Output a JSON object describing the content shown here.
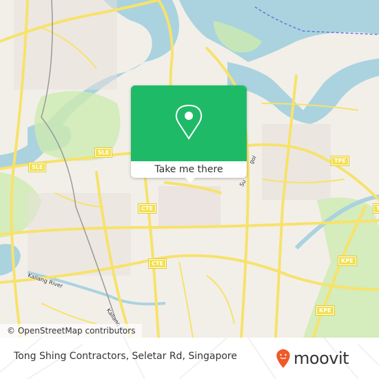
{
  "map": {
    "attribution": "© OpenStreetMap contributors",
    "highway_shields": [
      {
        "id": "sle-1",
        "label": "SLE"
      },
      {
        "id": "sle-2",
        "label": "SLE"
      },
      {
        "id": "cte-1",
        "label": "CTE"
      },
      {
        "id": "cte-2",
        "label": "CTE"
      },
      {
        "id": "tpe-1",
        "label": "TPE"
      },
      {
        "id": "tpe-2",
        "label": "T"
      },
      {
        "id": "kpe-1",
        "label": "KPE"
      },
      {
        "id": "kpe-2",
        "label": "KPE"
      }
    ],
    "labels": {
      "kallang_river": "Kallang River",
      "kallang_river_2": "Kallang R",
      "sungei_partial_1": "Su",
      "sungei_partial_2": "gol"
    },
    "colors": {
      "land": "#f2efe9",
      "water": "#aad3df",
      "park": "#cdebb0",
      "road": "#f7e26b",
      "accent": "#1fba67"
    }
  },
  "popup": {
    "icon": "map-pin-icon",
    "cta_label": "Take me there"
  },
  "footer": {
    "place_name": "Tong Shing Contractors, Seletar Rd, Singapore",
    "brand_name": "moovit",
    "brand_color": "#f05a28"
  }
}
